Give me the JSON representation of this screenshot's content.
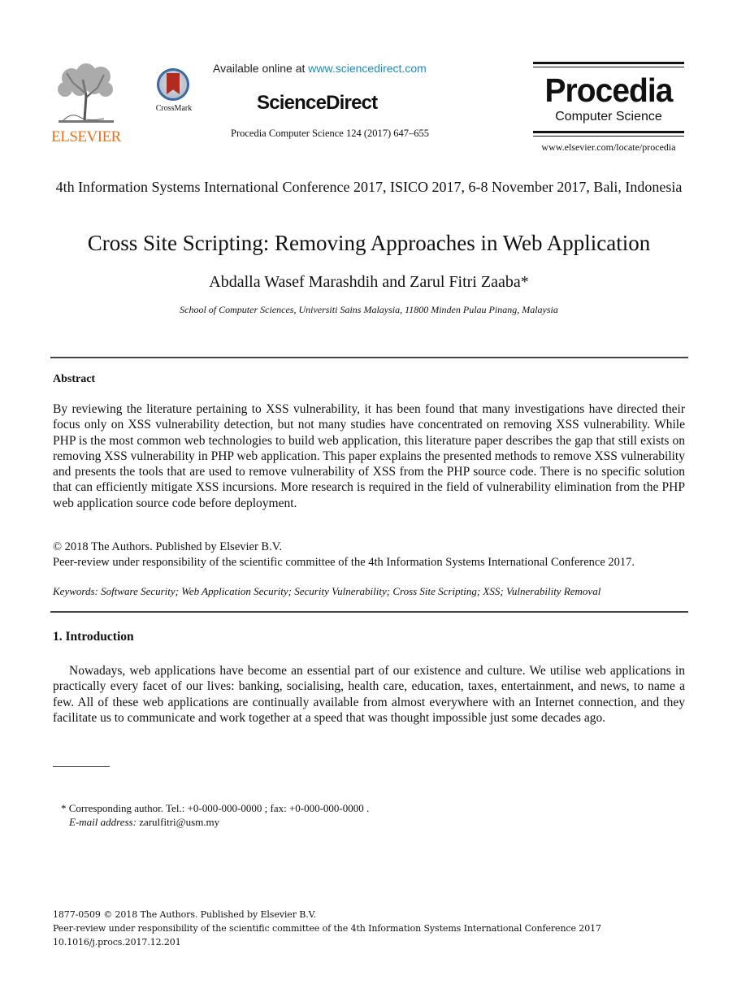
{
  "header": {
    "publisher_logo": {
      "icon": "elsevier-tree-icon",
      "wordmark": "ELSEVIER",
      "color": "#e9711c"
    },
    "crossmark": {
      "icon": "crossmark-icon",
      "label": "CrossMark"
    },
    "available_prefix": "Available online at ",
    "available_link": "www.sciencedirect.com",
    "link_color": "#1a8bc4",
    "platform_name": "ScienceDirect",
    "journal_reference": "Procedia Computer Science 124 (2017) 647–655",
    "journal_logo": {
      "title": "Procedia",
      "subtitle": "Computer Science",
      "url": "www.elsevier.com/locate/procedia"
    }
  },
  "paper": {
    "conference": "4th Information Systems International Conference 2017, ISICO 2017, 6-8 November 2017, Bali, Indonesia",
    "title": "Cross Site Scripting: Removing Approaches in Web Application",
    "authors": "Abdalla Wasef Marashdih and Zarul Fitri Zaaba*",
    "affiliation": "School of Computer Sciences, Universiti Sains Malaysia, 11800 Minden Pulau Pinang, Malaysia",
    "abstract_heading": "Abstract",
    "abstract": "By reviewing the literature pertaining to XSS vulnerability, it has been found that many investigations have directed their focus only on XSS vulnerability detection, but not many studies have concentrated on removing XSS vulnerability. While PHP is the most common web technologies to build web application, this literature paper describes the gap that still exists on removing XSS vulnerability in PHP web application. This paper explains the presented methods to remove XSS vulnerability and presents the tools that are used to remove vulnerability of XSS from the PHP source code. There is no specific solution that can efficiently mitigate XSS incursions. More research is required in the field of vulnerability elimination from the PHP web application source code before deployment.",
    "copyright": "© 2018 The Authors. Published by Elsevier B.V.",
    "peer_review": "Peer-review under responsibility of the scientific committee of the 4th Information Systems International Conference 2017.",
    "keywords": "Keywords: Software Security; Web Application Security; Security Vulnerability; Cross Site Scripting; XSS; Vulnerability Removal",
    "sections": [
      {
        "heading": "1. Introduction",
        "text": "Nowadays, web applications have become an essential part of our existence and culture. We utilise web applications in practically every facet of our lives: banking, socialising, health care, education, taxes, entertainment, and news, to name a few. All of these web applications are continually available from almost everywhere with an Internet connection, and they facilitate us to communicate and work together at a speed that was thought impossible just some decades ago."
      }
    ]
  },
  "footnote": {
    "corresponding": "* Corresponding author. Tel.: +0-000-000-0000 ; fax: +0-000-000-0000 .",
    "email_label": "E-mail address:",
    "email": " zarulfitri@usm.my"
  },
  "bottom": {
    "issn_line": "1877-0509 © 2018 The Authors. Published by Elsevier B.V.",
    "peer_review": "Peer-review under responsibility of the scientific committee of the 4th Information Systems International Conference 2017",
    "doi": "10.1016/j.procs.2017.12.201"
  }
}
